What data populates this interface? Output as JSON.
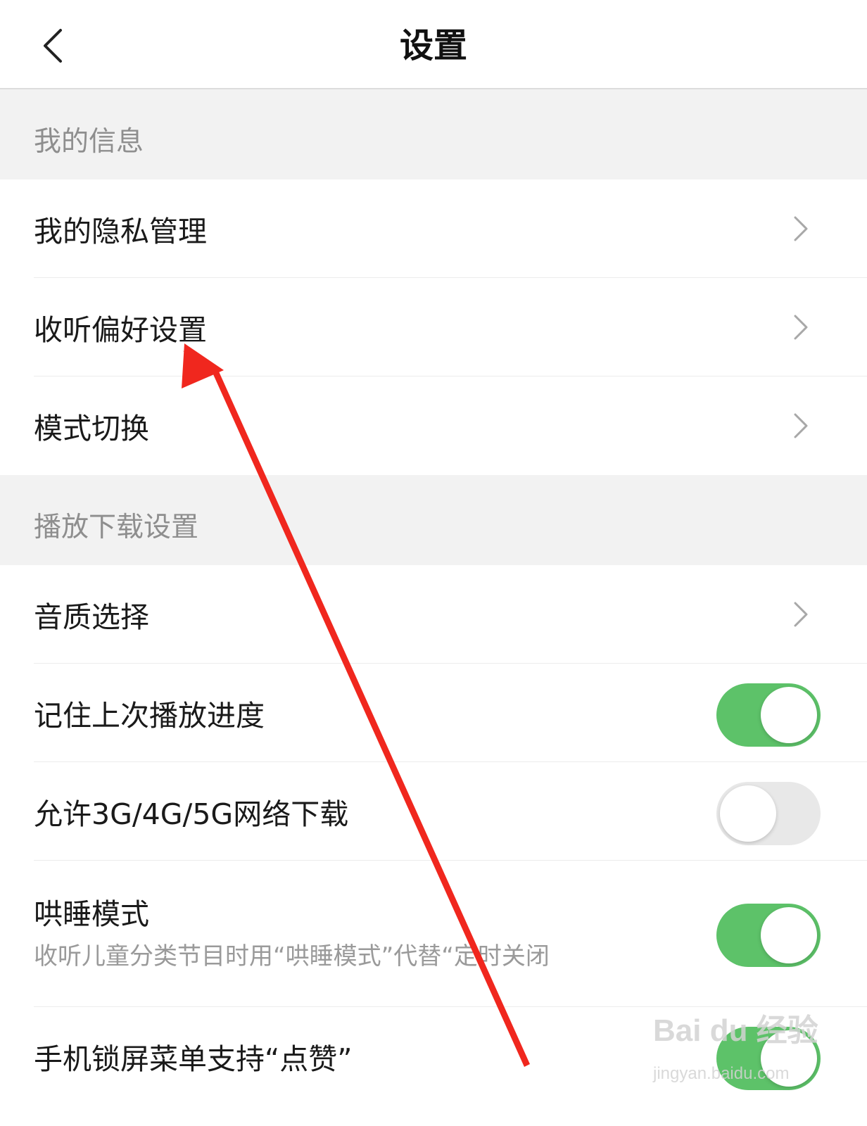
{
  "nav": {
    "title": "设置"
  },
  "sections": [
    {
      "label": "我的信息",
      "items": [
        {
          "label": "我的隐私管理",
          "control": "chevron"
        },
        {
          "label": "收听偏好设置",
          "control": "chevron"
        },
        {
          "label": "模式切换",
          "control": "chevron"
        }
      ]
    },
    {
      "label": "播放下载设置",
      "items": [
        {
          "label": "音质选择",
          "control": "chevron"
        },
        {
          "label": "记住上次播放进度",
          "control": "toggle",
          "on": true
        },
        {
          "label": "允许3G/4G/5G网络下载",
          "control": "toggle",
          "on": false
        },
        {
          "label": "哄睡模式",
          "subtitle": "收听儿童分类节目时用“哄睡模式”代替“定时关闭",
          "control": "toggle",
          "on": true
        },
        {
          "label": "手机锁屏菜单支持“点赞”",
          "control": "toggle",
          "on": true
        }
      ]
    }
  ],
  "colors": {
    "toggle_on": "#5dc269",
    "toggle_off": "#e8e8e8",
    "annotation_arrow": "#f0271e"
  },
  "watermark": {
    "brand": "Bai du 经验",
    "url": "jingyan.baidu.com"
  }
}
